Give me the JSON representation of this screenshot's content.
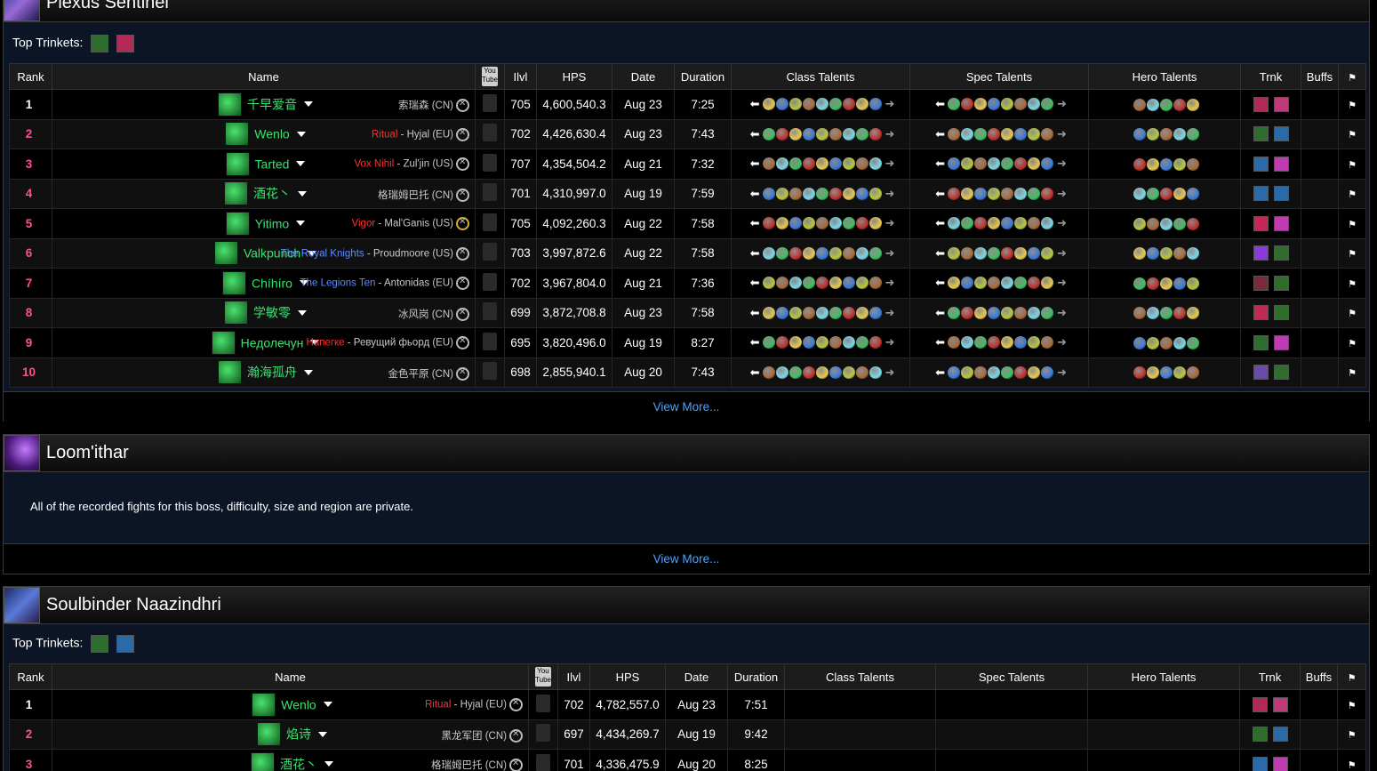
{
  "columns1": [
    "Rank",
    "Name",
    "YouTube",
    "Ilvl",
    "HPS",
    "Date",
    "Duration",
    "Class Talents",
    "Spec Talents",
    "Hero Talents",
    "Trnk",
    "Buffs"
  ],
  "sections": [
    {
      "boss": "Plexus Sentinel",
      "top_trinkets_label": "Top Trinkets:",
      "view_more": "View More...",
      "rows": [
        {
          "rank": "1",
          "name": "千早爱音",
          "guild": "",
          "server": "索瑞森 (CN)",
          "ilvl": "705",
          "hps": "4,600,540.3",
          "date": "Aug 23",
          "duration": "7:25"
        },
        {
          "rank": "2",
          "name": "Wenlo",
          "guild": "Ritual",
          "server": " - Hyjal (EU)",
          "ilvl": "702",
          "hps": "4,426,630.4",
          "date": "Aug 23",
          "duration": "7:43"
        },
        {
          "rank": "3",
          "name": "Tarted",
          "guild": "Vox Nihil",
          "server": " - Zul'jin (US)",
          "ilvl": "707",
          "hps": "4,354,504.2",
          "date": "Aug 21",
          "duration": "7:32"
        },
        {
          "rank": "4",
          "name": "酒花丶",
          "guild": "",
          "server": "格瑞姆巴托 (CN)",
          "ilvl": "701",
          "hps": "4,310,997.0",
          "date": "Aug 19",
          "duration": "7:59"
        },
        {
          "rank": "5",
          "name": "Yitimo",
          "guild": "Vigor",
          "server": " - Mal'Ganis (US)",
          "ilvl": "705",
          "hps": "4,092,260.3",
          "date": "Aug 22",
          "duration": "7:58"
        },
        {
          "rank": "6",
          "name": "Valkpunch",
          "guild": "The Royal Knights",
          "server": " - Proudmoore (US)",
          "ilvl": "703",
          "hps": "3,997,872.6",
          "date": "Aug 22",
          "duration": "7:58"
        },
        {
          "rank": "7",
          "name": "Chíhíro",
          "guild": "The Legions Ten",
          "server": " - Antonidas (EU)",
          "ilvl": "702",
          "hps": "3,967,804.0",
          "date": "Aug 21",
          "duration": "7:36"
        },
        {
          "rank": "8",
          "name": "学敏零",
          "guild": "",
          "server": "冰风岗 (CN)",
          "ilvl": "699",
          "hps": "3,872,708.8",
          "date": "Aug 23",
          "duration": "7:58"
        },
        {
          "rank": "9",
          "name": "Недолечун",
          "guild": "Напегке",
          "server": " - Ревущий фьорд (EU)",
          "ilvl": "695",
          "hps": "3,820,496.0",
          "date": "Aug 19",
          "duration": "8:27"
        },
        {
          "rank": "10",
          "name": "瀚海孤舟",
          "guild": "",
          "server": "金色平原 (CN)",
          "ilvl": "698",
          "hps": "2,855,940.1",
          "date": "Aug 20",
          "duration": "7:43"
        }
      ]
    },
    {
      "boss": "Loom'ithar",
      "private_msg": "All of the recorded fights for this boss, difficulty, size and region are private.",
      "view_more": "View More..."
    },
    {
      "boss": "Soulbinder Naazindhri",
      "top_trinkets_label": "Top Trinkets:",
      "rows": [
        {
          "rank": "1",
          "name": "Wenlo",
          "guild": "Ritual",
          "server": " - Hyjal (EU)",
          "ilvl": "702",
          "hps": "4,782,557.0",
          "date": "Aug 23",
          "duration": "7:51"
        },
        {
          "rank": "2",
          "name": "焰诗",
          "guild": "",
          "server": "黑龙军团 (CN)",
          "ilvl": "697",
          "hps": "4,434,269.7",
          "date": "Aug 19",
          "duration": "9:42"
        },
        {
          "rank": "3",
          "name": "酒花丶",
          "guild": "",
          "server": "格瑞姆巴托 (CN)",
          "ilvl": "701",
          "hps": "4,336,475.9",
          "date": "Aug 20",
          "duration": "8:25"
        }
      ]
    }
  ],
  "colors": {
    "player": "#39e36f",
    "rank_gold": "#ffb300",
    "rank_pink": "#ff4f9a",
    "hps": "#e6e97a",
    "link": "#4aa3ff",
    "guild_red": "#ff3030",
    "guild_blue": "#5b8cff"
  }
}
